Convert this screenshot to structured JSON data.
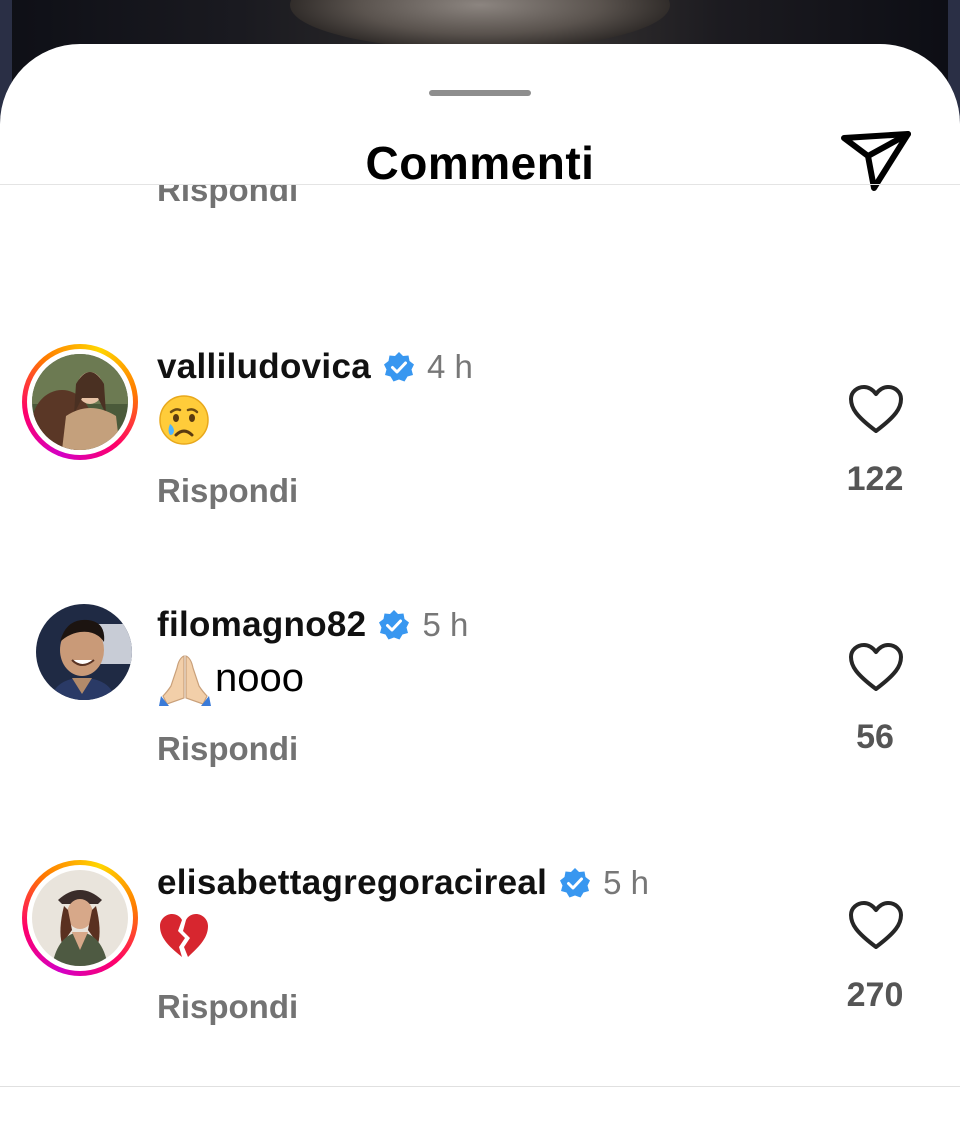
{
  "sheet": {
    "title": "Commenti",
    "send_icon": "paper-plane-icon"
  },
  "partial_reply_label": "Rispondi",
  "comments": [
    {
      "username": "valliludovica",
      "verified": true,
      "time": "4 h",
      "emoji": "crying-face",
      "text": "",
      "reply_label": "Rispondi",
      "like_count": "122",
      "has_story_ring": true
    },
    {
      "username": "filomagno82",
      "verified": true,
      "time": "5 h",
      "emoji": "folded-hands",
      "text": "nooo",
      "reply_label": "Rispondi",
      "like_count": "56",
      "has_story_ring": false
    },
    {
      "username": "elisabettagregoracireal",
      "verified": true,
      "time": "5 h",
      "emoji": "broken-heart",
      "text": "",
      "reply_label": "Rispondi",
      "like_count": "270",
      "has_story_ring": true
    }
  ],
  "colors": {
    "verified_badge": "#3897f0",
    "story_ring": [
      "#d300c5",
      "#ff0069",
      "#ff7a00",
      "#ffd600"
    ],
    "secondary_text": "#737373"
  }
}
